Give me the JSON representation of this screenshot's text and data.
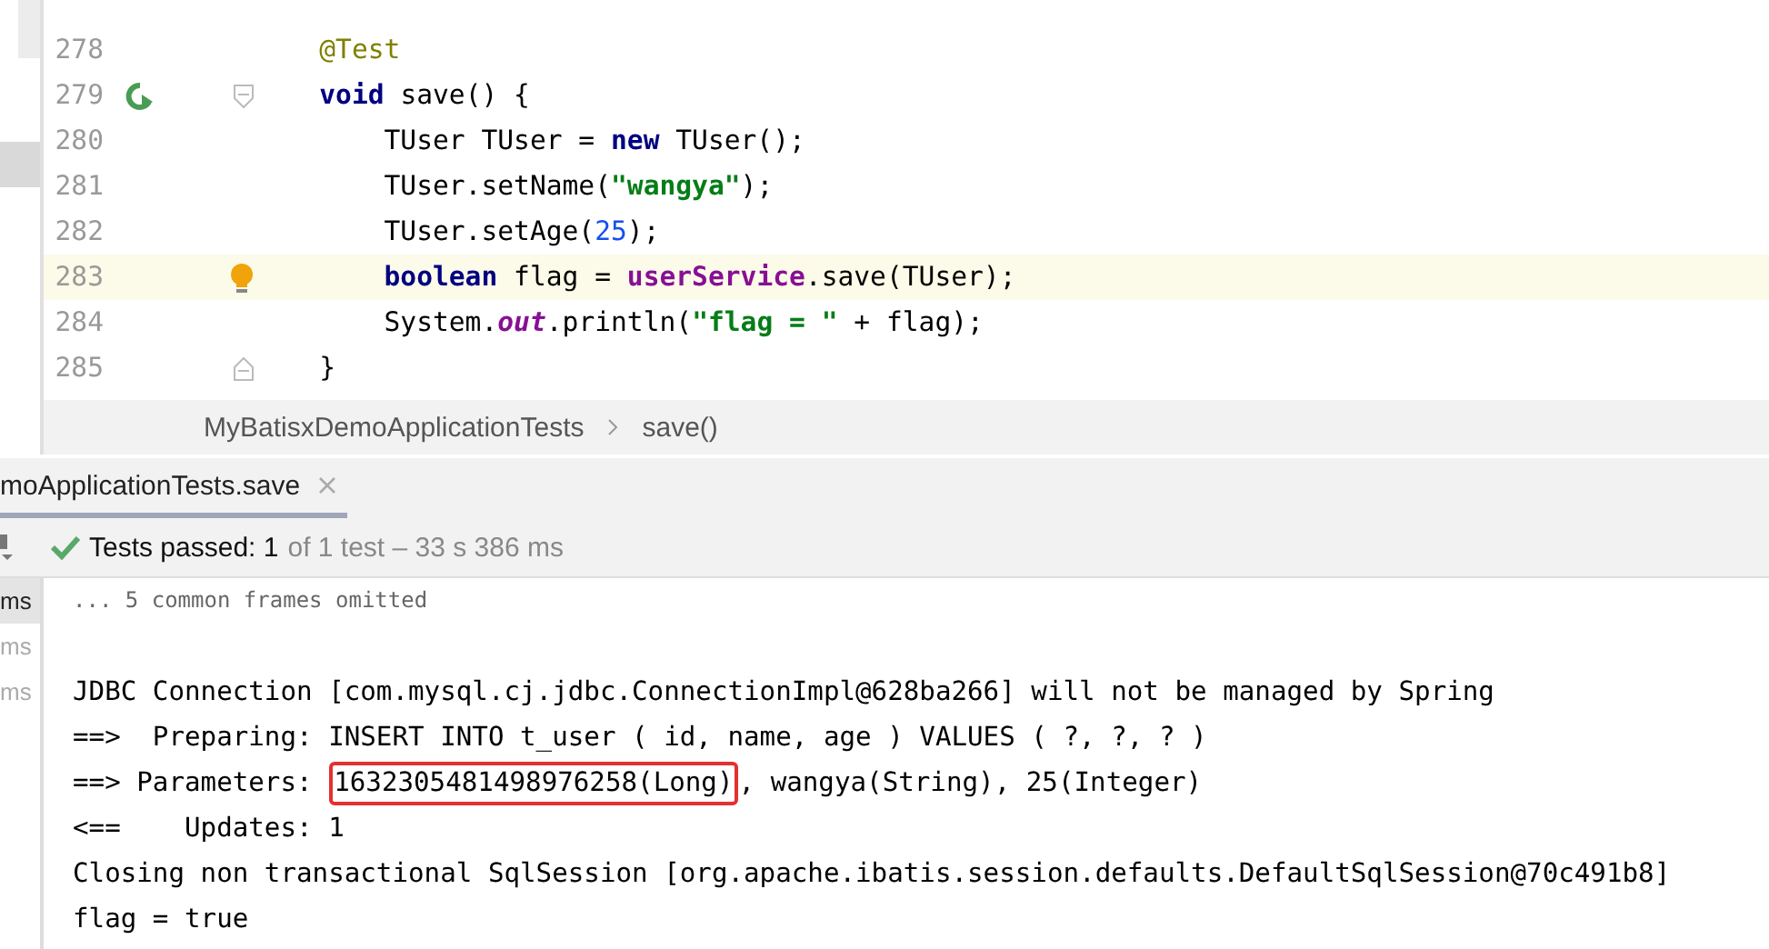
{
  "editor": {
    "lines": [
      {
        "number": "278",
        "current": false,
        "kind": "plain",
        "segments": [
          {
            "kind": "annotation",
            "text": "    @Test"
          }
        ]
      },
      {
        "number": "279",
        "current": false,
        "kind": "run",
        "segments": [
          {
            "kind": "keyword",
            "text": "    void"
          },
          {
            "kind": "plain",
            "text": " save() {"
          }
        ]
      },
      {
        "number": "280",
        "current": false,
        "kind": "plain",
        "segments": [
          {
            "kind": "plain",
            "text": "        TUser TUser = "
          },
          {
            "kind": "keyword",
            "text": "new"
          },
          {
            "kind": "plain",
            "text": " TUser();"
          }
        ]
      },
      {
        "number": "281",
        "current": false,
        "kind": "plain",
        "segments": [
          {
            "kind": "plain",
            "text": "        TUser.setName("
          },
          {
            "kind": "string",
            "text": "\"wangya\""
          },
          {
            "kind": "plain",
            "text": ");"
          }
        ]
      },
      {
        "number": "282",
        "current": false,
        "kind": "plain",
        "segments": [
          {
            "kind": "plain",
            "text": "        TUser.setAge("
          },
          {
            "kind": "number",
            "text": "25"
          },
          {
            "kind": "plain",
            "text": ");"
          }
        ]
      },
      {
        "number": "283",
        "current": true,
        "kind": "bulb",
        "segments": [
          {
            "kind": "keyword",
            "text": "        boolean"
          },
          {
            "kind": "plain",
            "text": " flag = "
          },
          {
            "kind": "field",
            "text": "userService"
          },
          {
            "kind": "plain",
            "text": ".save(TUser);"
          }
        ]
      },
      {
        "number": "284",
        "current": false,
        "kind": "plain",
        "segments": [
          {
            "kind": "plain",
            "text": "        System."
          },
          {
            "kind": "static",
            "text": "out"
          },
          {
            "kind": "plain",
            "text": ".println("
          },
          {
            "kind": "string",
            "text": "\"flag = \""
          },
          {
            "kind": "plain",
            "text": " + flag);"
          }
        ]
      },
      {
        "number": "285",
        "current": false,
        "kind": "fold",
        "segments": [
          {
            "kind": "plain",
            "text": "    }"
          }
        ]
      }
    ]
  },
  "breadcrumb": [
    {
      "label": "MyBatisxDemoApplicationTests"
    },
    {
      "label": "save()"
    }
  ],
  "run_panel": {
    "tab": {
      "label": "moApplicationTests.save",
      "selected": true
    },
    "status": {
      "passed": "Tests passed: 1",
      "detail": "of 1 test – 33 s 386 ms"
    },
    "side_times": [
      {
        "label": "ms",
        "selected": true
      },
      {
        "label": "ms",
        "selected": false
      },
      {
        "label": "ms",
        "selected": false
      }
    ],
    "console": [
      {
        "text": "... 5 common frames omitted"
      },
      {
        "text": "JDBC Connection [com.mysql.cj.jdbc.ConnectionImpl@628ba266] will not be managed by Spring"
      },
      {
        "text": "==>  Preparing: INSERT INTO t_user ( id, name, age ) VALUES ( ?, ?, ? )"
      },
      {
        "text": "==> Parameters: ",
        "highlight": "1632305481498976258(Long)",
        "after": ", wangya(String), 25(Integer)"
      },
      {
        "text": "<==    Updates: 1"
      },
      {
        "text": "Closing non transactional SqlSession [org.apache.ibatis.session.defaults.DefaultSqlSession@70c491b8]"
      },
      {
        "text": "flag = true"
      }
    ]
  }
}
